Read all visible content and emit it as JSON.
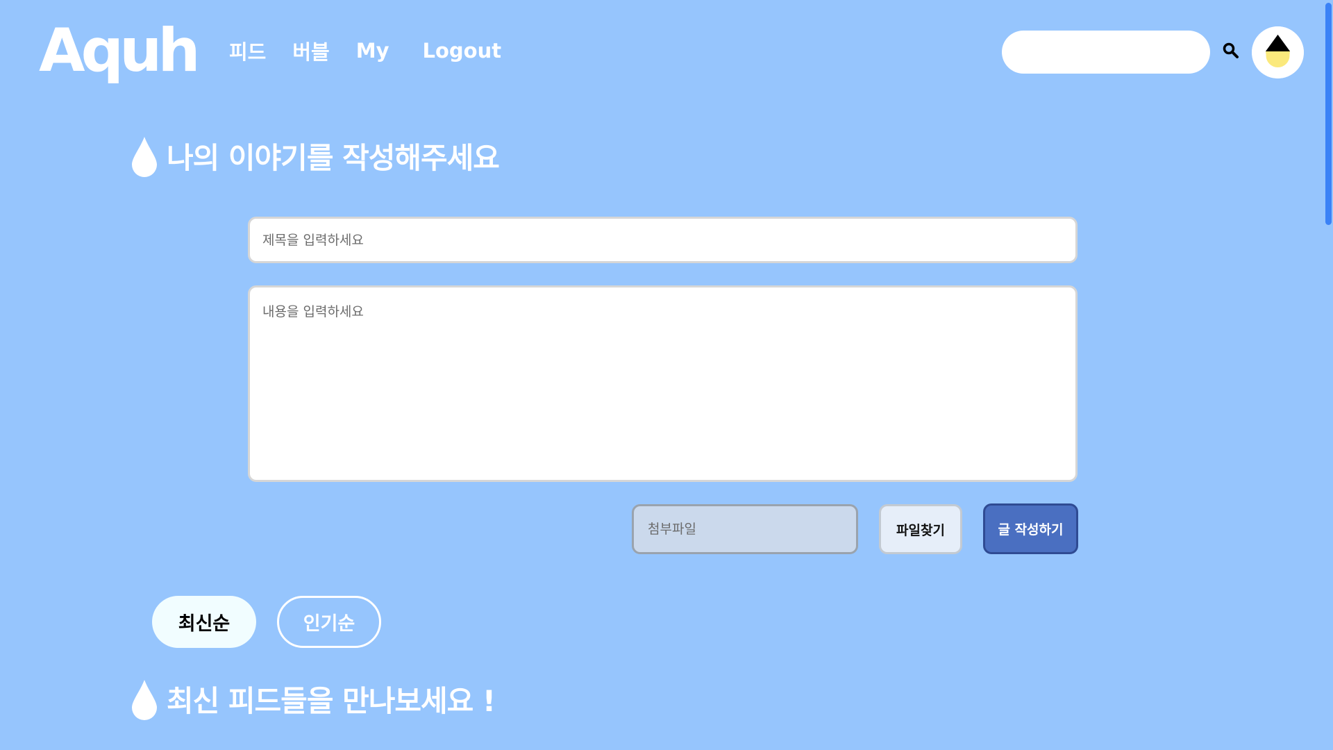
{
  "header": {
    "logo_text": "Aquh",
    "nav": {
      "feed": "피드",
      "bubble": "버블",
      "my": "My",
      "logout": "Logout"
    },
    "search_icon": "search-icon",
    "avatar_icon": "water-drop-avatar-icon"
  },
  "write_section": {
    "heading": "나의 이야기를 작성해주세요",
    "title_placeholder": "제목을 입력하세요",
    "content_placeholder": "내용을 입력하세요",
    "attachment_placeholder": "첨부파일",
    "find_file_label": "파일찾기",
    "submit_label": "글 작성하기"
  },
  "sort": {
    "latest_label": "최신순",
    "popular_label": "인기순",
    "selected": "최신순"
  },
  "feed_section": {
    "heading": "최신 피드들을 만나보세요 !"
  },
  "colors": {
    "background": "#96c5fd",
    "submit_button": "#4a6fc1",
    "attachment_field": "#cbd9ec",
    "selected_sort": "#f1fdff",
    "avatar_drop_top": "#000000",
    "avatar_drop_bottom": "#fbe97c"
  }
}
